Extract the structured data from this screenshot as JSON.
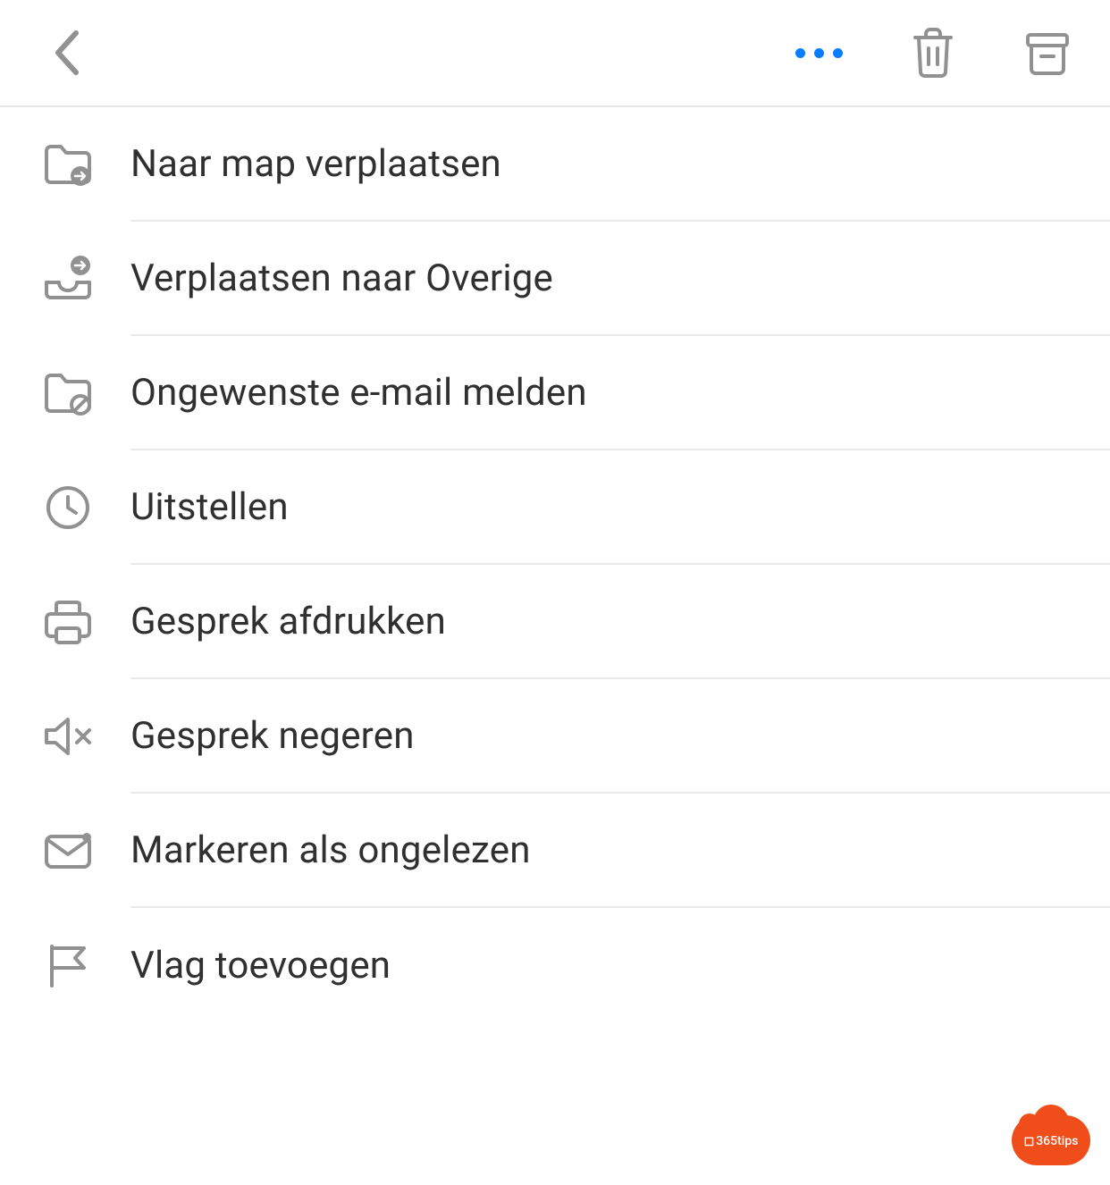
{
  "menu": {
    "items": [
      {
        "id": "move-folder",
        "icon": "folder-move-icon",
        "label": "Naar map verplaatsen"
      },
      {
        "id": "move-other",
        "icon": "tray-move-icon",
        "label": "Verplaatsen naar Overige"
      },
      {
        "id": "report-junk",
        "icon": "folder-block-icon",
        "label": "Ongewenste e-mail melden"
      },
      {
        "id": "snooze",
        "icon": "clock-icon",
        "label": "Uitstellen"
      },
      {
        "id": "print",
        "icon": "printer-icon",
        "label": "Gesprek afdrukken"
      },
      {
        "id": "ignore",
        "icon": "speaker-mute-icon",
        "label": "Gesprek negeren"
      },
      {
        "id": "mark-unread",
        "icon": "mail-unread-icon",
        "label": "Markeren als ongelezen"
      },
      {
        "id": "flag",
        "icon": "flag-icon",
        "label": "Vlag toevoegen"
      }
    ]
  },
  "badge": {
    "text": "365tips"
  },
  "colors": {
    "iconGrey": "#919191",
    "accentBlue": "#0a7cff",
    "badgeOrange": "#ef4e1b",
    "textDark": "#303030"
  }
}
